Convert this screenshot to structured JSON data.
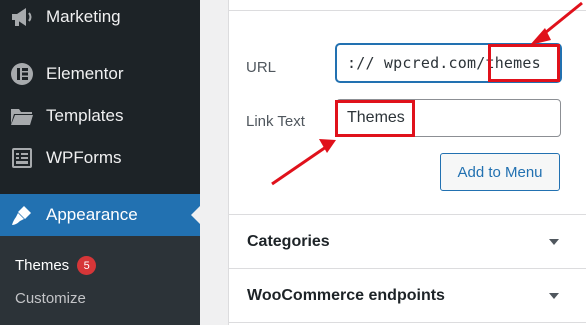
{
  "sidebar": {
    "items": [
      {
        "label": "Marketing",
        "icon": "megaphone-icon"
      },
      {
        "label": "Elementor",
        "icon": "elementor-icon"
      },
      {
        "label": "Templates",
        "icon": "folder-icon"
      },
      {
        "label": "WPForms",
        "icon": "wpforms-icon"
      },
      {
        "label": "Appearance",
        "icon": "paintbrush-icon"
      }
    ],
    "submenu": [
      {
        "label": "Themes",
        "badge": "5"
      },
      {
        "label": "Customize"
      }
    ]
  },
  "custom_link": {
    "url_label": "URL",
    "url_value": ":// wpcred.com/themes",
    "link_text_label": "Link Text",
    "link_text_value": "Themes",
    "add_button": "Add to Menu"
  },
  "sections": [
    {
      "title": "Categories"
    },
    {
      "title": "WooCommerce endpoints"
    }
  ],
  "colors": {
    "sidebar_bg": "#1d2327",
    "active_bg": "#2271b1",
    "badge": "#d63638",
    "annotation": "#e0111b"
  }
}
